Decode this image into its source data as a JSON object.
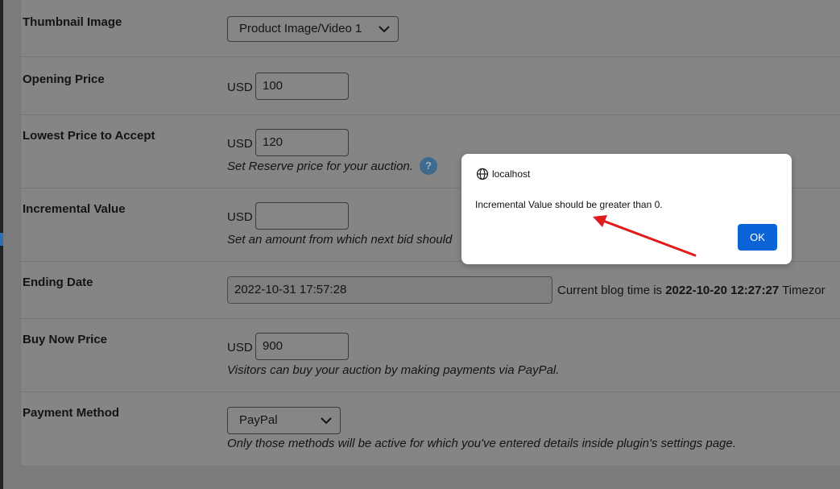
{
  "form": {
    "thumbnail": {
      "label": "Thumbnail Image",
      "value": "Product Image/Video 1"
    },
    "opening_price": {
      "label": "Opening Price",
      "currency": "USD",
      "value": "100"
    },
    "lowest_price": {
      "label": "Lowest Price to Accept",
      "currency": "USD",
      "value": "120",
      "description": "Set Reserve price for your auction.",
      "help": "?"
    },
    "incremental": {
      "label": "Incremental Value",
      "currency": "USD",
      "value": "",
      "description": "Set an amount from which next bid should"
    },
    "ending_date": {
      "label": "Ending Date",
      "value": "2022-10-31 17:57:28",
      "blog_time_prefix": "Current blog time is ",
      "blog_time": "2022-10-20 12:27:27",
      "blog_time_suffix": " Timezor"
    },
    "buy_now": {
      "label": "Buy Now Price",
      "currency": "USD",
      "value": "900",
      "description": "Visitors can buy your auction by making payments via PayPal."
    },
    "payment": {
      "label": "Payment Method",
      "value": "PayPal",
      "description": "Only those methods will be active for which you've entered details inside plugin's settings page."
    }
  },
  "dialog": {
    "host": "localhost",
    "message": "Incremental Value should be greater than 0.",
    "ok_label": "OK"
  },
  "colors": {
    "ok_button": "#0b63d8",
    "annotation_arrow": "#e01b1b",
    "overlay": "#7b7b7b"
  }
}
